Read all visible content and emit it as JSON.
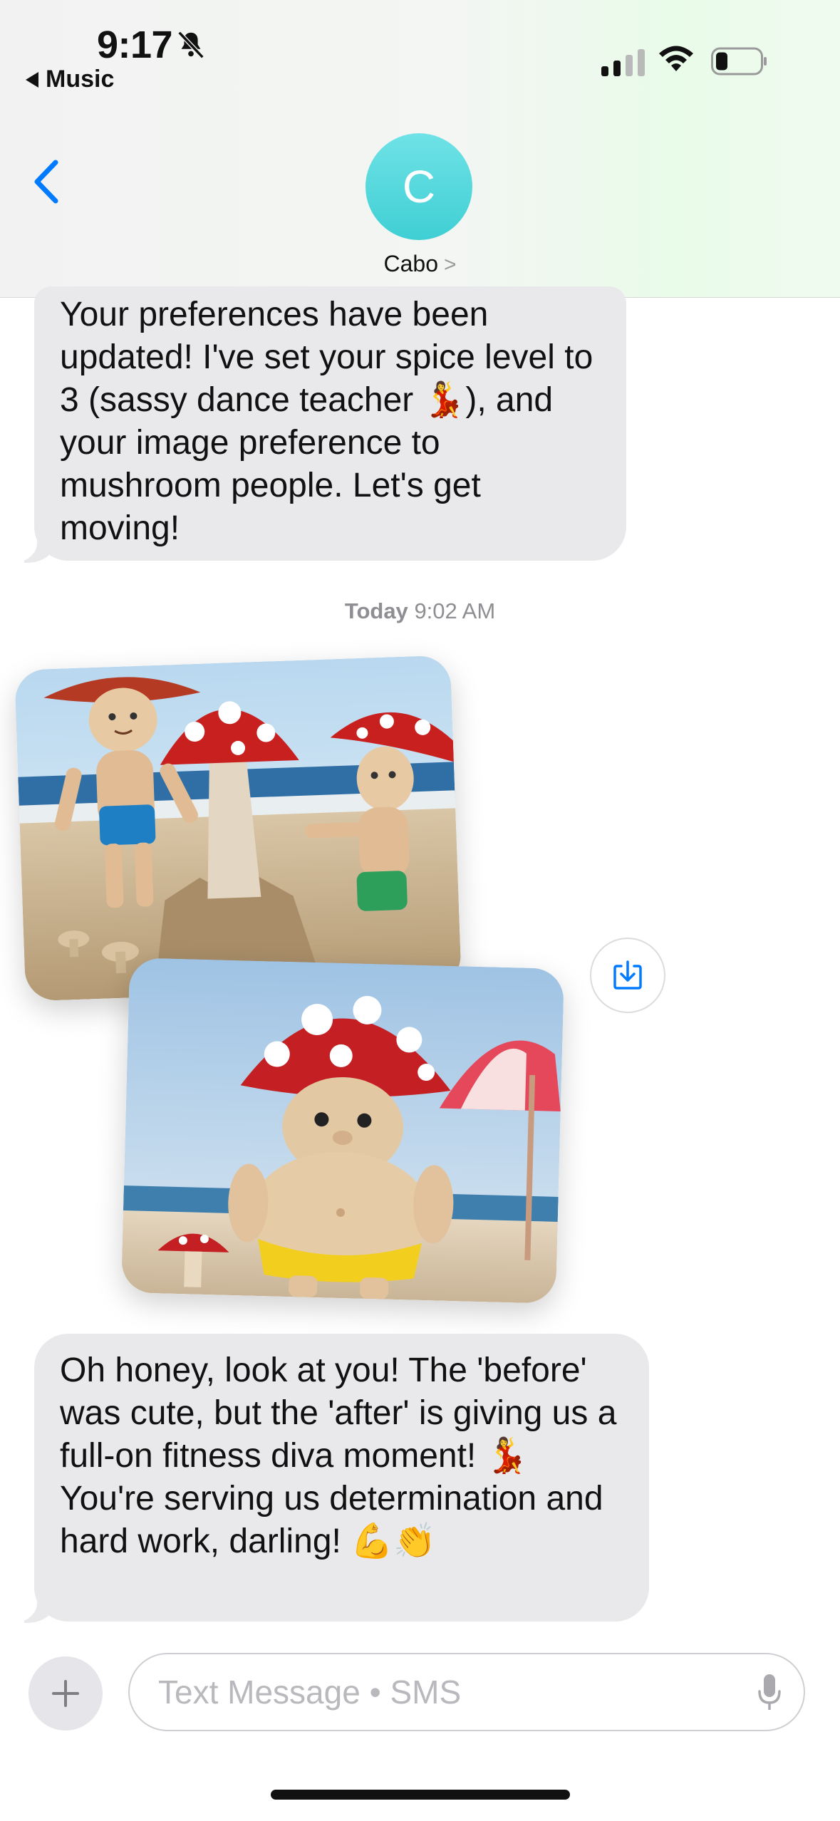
{
  "status_bar": {
    "time": "9:17",
    "back_app": "Music"
  },
  "header": {
    "contact_initial": "C",
    "contact_name": "Cabo",
    "name_chevron": ">"
  },
  "messages": [
    {
      "from": "contact",
      "text": "Your preferences have been updated! I've set your spice level to 3 (sassy dance teacher 💃), and your image preference to mushroom people. Let's get moving!"
    },
    {
      "from": "contact",
      "text": "Oh honey, look at you! The 'before' was cute, but the 'after' is giving us a full-on fitness diva moment! 💃 You're serving us determination and hard work, darling! 💪👏"
    }
  ],
  "timestamp": {
    "day": "Today",
    "time": "9:02 AM"
  },
  "composer": {
    "placeholder": "Text Message • SMS"
  },
  "colors": {
    "ios_blue": "#007aff",
    "bubble_gray": "#e9e9eb",
    "avatar_teal": "#4fd6db"
  },
  "icons": [
    "bell-slash-icon",
    "signal-icon",
    "wifi-icon",
    "battery-icon",
    "back-chevron-icon",
    "save-image-icon",
    "plus-icon",
    "mic-icon"
  ]
}
